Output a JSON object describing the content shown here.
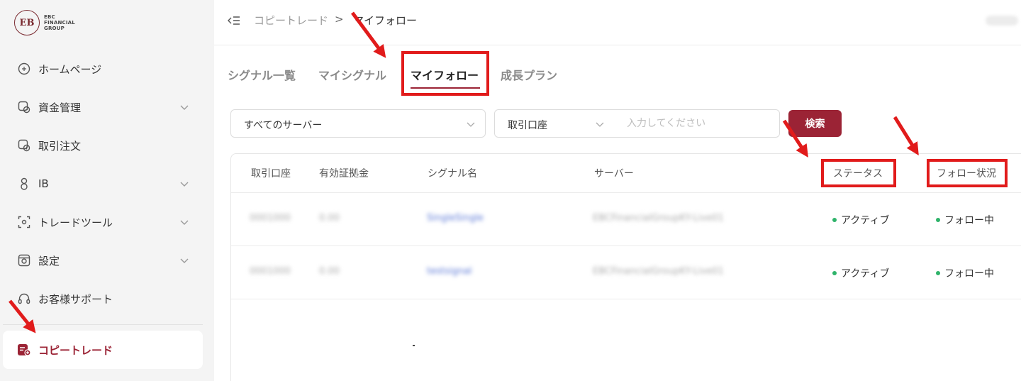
{
  "brand": {
    "mark": "EB",
    "line1": "EBC",
    "line2": "FINANCIAL",
    "line3": "GROUP",
    "accent_color": "#9b2335"
  },
  "sidebar": {
    "items": [
      {
        "label": "ホームページ",
        "icon": "home-icon",
        "expandable": false
      },
      {
        "label": "資金管理",
        "icon": "funds-icon",
        "expandable": true
      },
      {
        "label": "取引注文",
        "icon": "order-icon",
        "expandable": false
      },
      {
        "label": "IB",
        "icon": "ib-icon",
        "expandable": true
      },
      {
        "label": "トレードツール",
        "icon": "tool-icon",
        "expandable": true
      },
      {
        "label": "設定",
        "icon": "settings-icon",
        "expandable": true
      },
      {
        "label": "お客様サポート",
        "icon": "headset-icon",
        "expandable": false
      },
      {
        "label": "コピートレード",
        "icon": "copy-trade-icon",
        "expandable": false,
        "active": true
      }
    ]
  },
  "header": {
    "breadcrumb_parent": "コピートレード",
    "breadcrumb_separator": ">",
    "breadcrumb_current": "マイフォロー"
  },
  "tabs": [
    {
      "label": "シグナル一覧"
    },
    {
      "label": "マイシグナル"
    },
    {
      "label": "マイフォロー",
      "active": true
    },
    {
      "label": "成長プラン"
    }
  ],
  "filters": {
    "server_select": "すべてのサーバー",
    "account_select": "取引口座",
    "input_placeholder": "入力してください",
    "search_label": "検索"
  },
  "table": {
    "columns": [
      "取引口座",
      "有効証拠金",
      "シグナル名",
      "サーバー",
      "ステータス",
      "フォロー状況"
    ],
    "rows": [
      {
        "account": "0001000",
        "equity": "0.00",
        "signal": "SingleSingle",
        "server": "EBCFinancialGroupKY-Live01",
        "status": "アクティブ",
        "follow": "フォロー中"
      },
      {
        "account": "0001000",
        "equity": "0.00",
        "signal": "testsignal",
        "server": "EBCFinancialGroupKY-Live01",
        "status": "アクティブ",
        "follow": "フォロー中"
      }
    ]
  },
  "colors": {
    "annotation": "#e11b1b",
    "status_dot": "#2fb36a"
  }
}
